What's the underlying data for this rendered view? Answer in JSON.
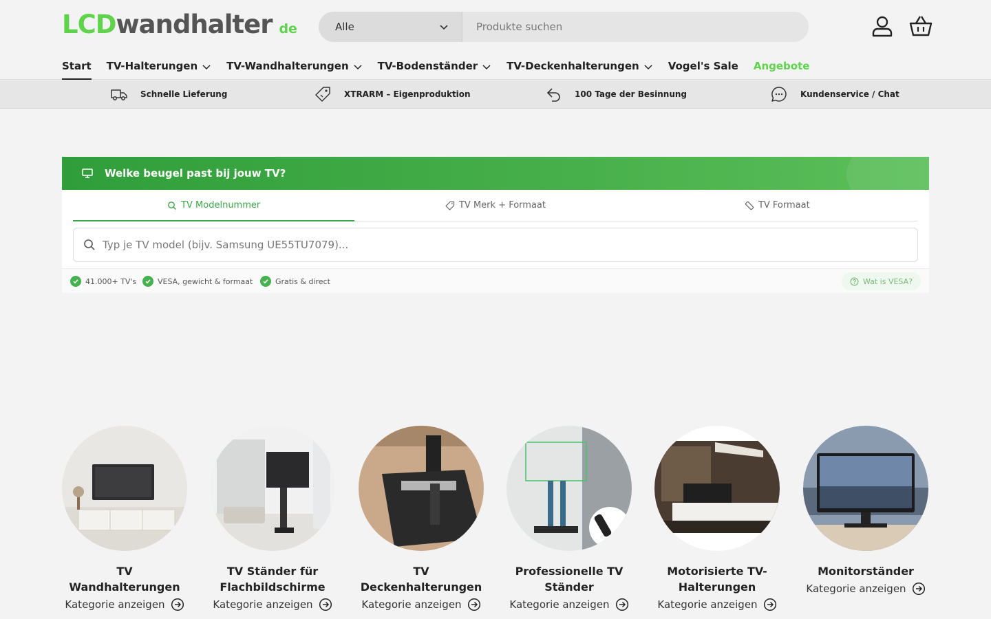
{
  "logo": {
    "part1": "LCD",
    "part2": "wandhalter",
    "suffix": "de"
  },
  "search": {
    "category": "Alle",
    "placeholder": "Produkte suchen"
  },
  "nav": [
    {
      "label": "Start",
      "dropdown": false
    },
    {
      "label": "TV-Halterungen",
      "dropdown": true
    },
    {
      "label": "TV-Wandhalterungen",
      "dropdown": true
    },
    {
      "label": "TV-Bodenständer",
      "dropdown": true
    },
    {
      "label": "TV-Deckenhalterungen",
      "dropdown": true
    },
    {
      "label": "Vogel's Sale",
      "dropdown": false
    },
    {
      "label": "Angebote",
      "dropdown": false
    }
  ],
  "usp": [
    {
      "label": "Schnelle Lieferung",
      "icon": "truck-icon"
    },
    {
      "label": "XTRARM – Eigenproduktion",
      "icon": "tag-icon"
    },
    {
      "label": "100 Tage der Besinnung",
      "icon": "return-arrow-icon"
    },
    {
      "label": "Kundenservice / Chat",
      "icon": "chat-icon"
    }
  ],
  "finder": {
    "title": "Welke beugel past bij jouw TV?",
    "tabs": [
      "TV Modelnummer",
      "TV Merk + Formaat",
      "TV Formaat"
    ],
    "input_placeholder": "Typ je TV model (bijv. Samsung UE55TU7079)...",
    "checks": [
      "41.000+ TV's",
      "VESA, gewicht & formaat",
      "Gratis & direct"
    ],
    "vesa_link": "Wat is VESA?"
  },
  "categories": [
    {
      "title": "TV Wandhalterungen",
      "link": "Kategorie anzeigen"
    },
    {
      "title": "TV Ständer für Flachbildschirme",
      "link": "Kategorie anzeigen"
    },
    {
      "title": "TV Deckenhalterungen",
      "link": "Kategorie anzeigen"
    },
    {
      "title": "Professionelle TV Ständer",
      "link": "Kategorie anzeigen"
    },
    {
      "title": "Motorisierte TV-Halterungen",
      "link": "Kategorie anzeigen"
    },
    {
      "title": "Monitorständer",
      "link": "Kategorie anzeigen"
    }
  ],
  "colors": {
    "brand_green": "#5fd34b",
    "finder_green": "#3aa64a"
  }
}
